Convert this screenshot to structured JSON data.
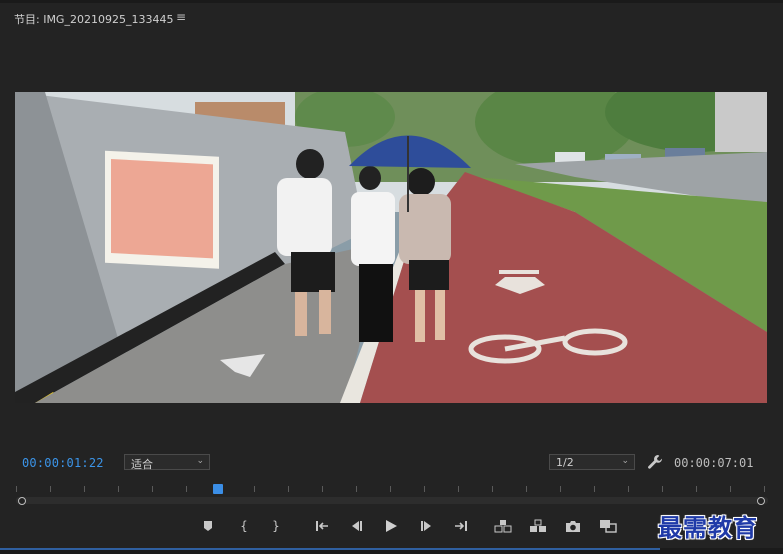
{
  "panel": {
    "title": "节目: IMG_20210925_133445",
    "menu_icon": "hamburger-menu-icon"
  },
  "controls": {
    "current_timecode": "00:00:01:22",
    "fit_option": "适合",
    "resolution_option": "1/2",
    "settings_icon": "wrench-icon",
    "duration_timecode": "00:00:07:01"
  },
  "timeline": {
    "playhead_position_fraction": 0.27
  },
  "transport_buttons": [
    {
      "name": "add-marker-button",
      "icon": "marker-icon"
    },
    {
      "name": "mark-in-button",
      "icon": "mark-in-icon"
    },
    {
      "name": "mark-out-button",
      "icon": "mark-out-icon"
    },
    {
      "name": "go-to-in-button",
      "icon": "go-to-in-icon"
    },
    {
      "name": "step-back-button",
      "icon": "step-back-icon"
    },
    {
      "name": "play-button",
      "icon": "play-icon"
    },
    {
      "name": "step-forward-button",
      "icon": "step-forward-icon"
    },
    {
      "name": "go-to-out-button",
      "icon": "go-to-out-icon"
    },
    {
      "name": "lift-button",
      "icon": "lift-icon"
    },
    {
      "name": "extract-button",
      "icon": "extract-icon"
    },
    {
      "name": "export-frame-button",
      "icon": "camera-icon"
    },
    {
      "name": "comparison-view-button",
      "icon": "comparison-icon"
    }
  ],
  "watermark": "最需教育",
  "colors": {
    "accent_blue": "#3b94e8",
    "background": "#232323"
  }
}
